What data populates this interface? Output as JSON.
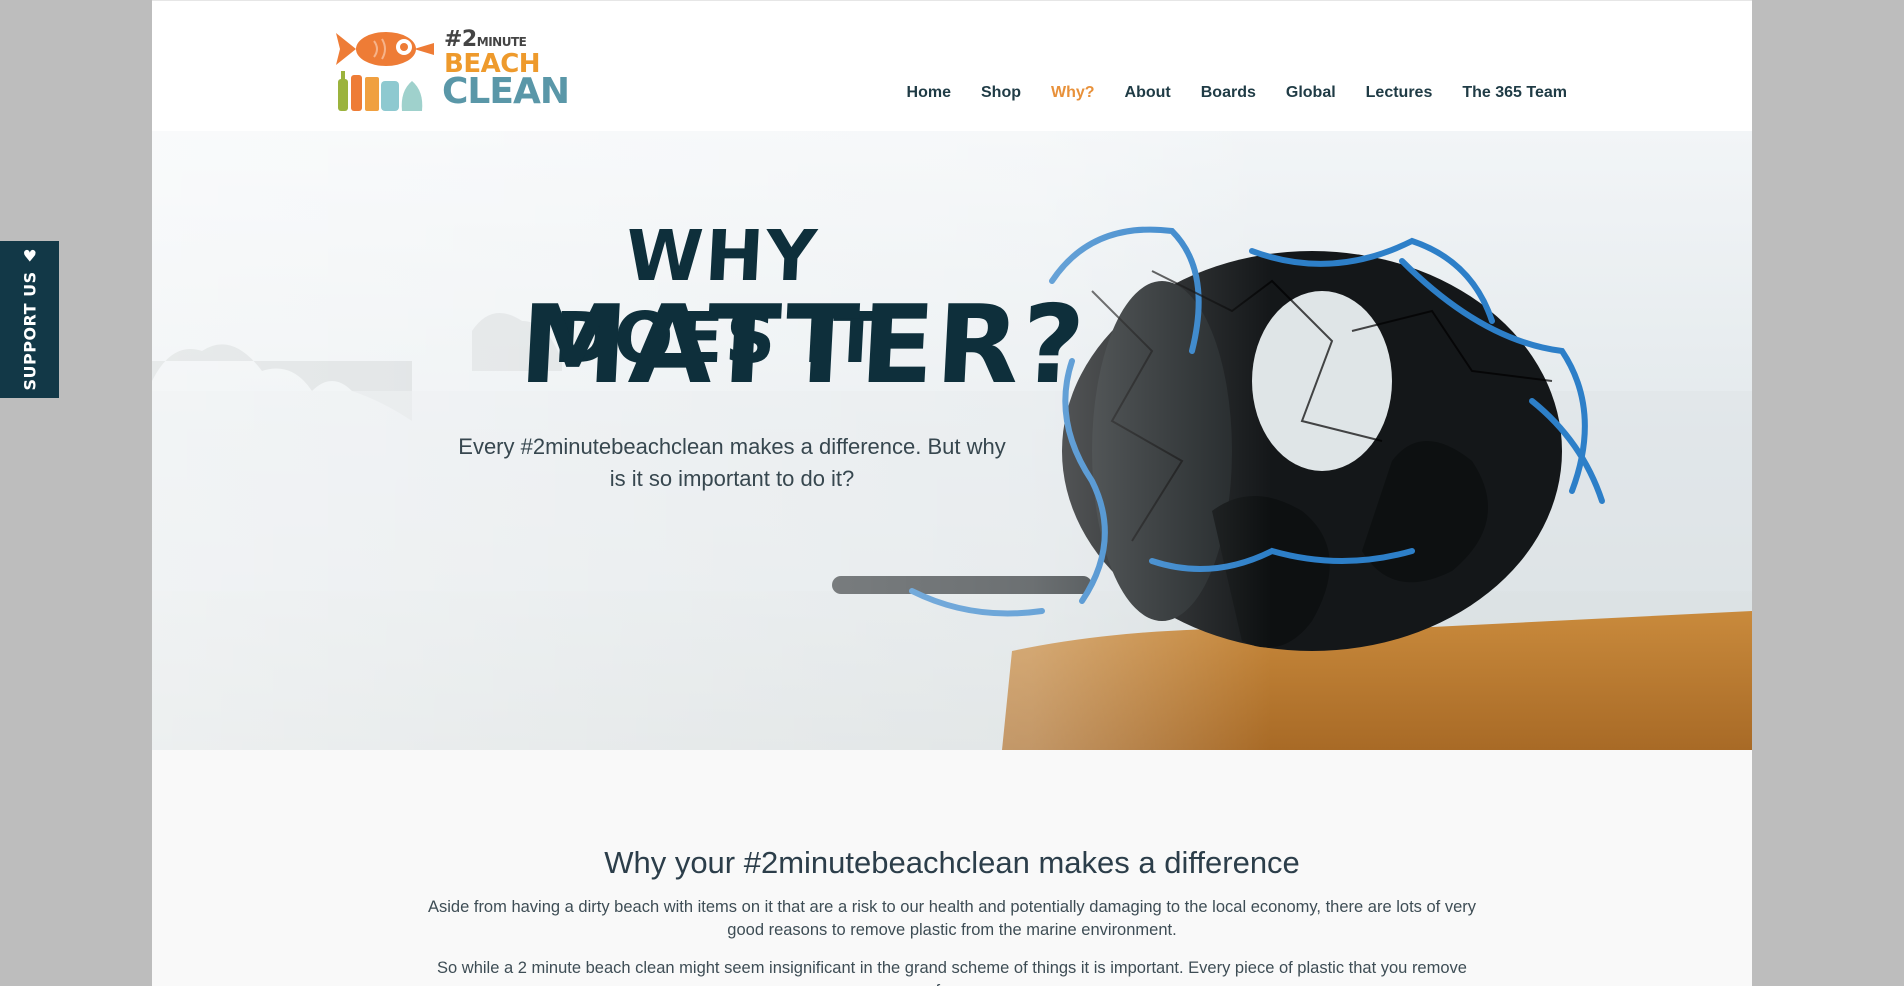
{
  "logo": {
    "line1": "#2",
    "line1_small": "MINUTE",
    "line2": "BEACH",
    "line3": "CLEAN"
  },
  "nav": {
    "items": [
      {
        "label": "Home"
      },
      {
        "label": "Shop"
      },
      {
        "label": "Why?"
      },
      {
        "label": "About"
      },
      {
        "label": "Boards"
      },
      {
        "label": "Global"
      },
      {
        "label": "Lectures"
      },
      {
        "label": "The 365 Team"
      }
    ],
    "active_index": 2
  },
  "hero": {
    "title_line1": "WHY DOES IT",
    "title_line2": "MATTER?",
    "subtitle": "Every #2minutebeachclean makes a difference. But why is it so important to do it?"
  },
  "content": {
    "heading": "Why your #2minutebeachclean makes a difference",
    "paragraph1": "Aside from having a dirty beach with items on it that are a risk to our health and potentially damaging to the local economy, there are lots of very good reasons to remove plastic from the marine environment.",
    "paragraph2": "So while a 2 minute beach clean might seem insignificant in the grand scheme of things it is important. Every piece of plastic that you remove from"
  },
  "support_tab": {
    "label": "SUPPORT US",
    "icon": "heart-icon"
  },
  "colors": {
    "brand_dark": "#123847",
    "accent_orange": "#e8913a",
    "logo_blue": "#5a97a8"
  }
}
